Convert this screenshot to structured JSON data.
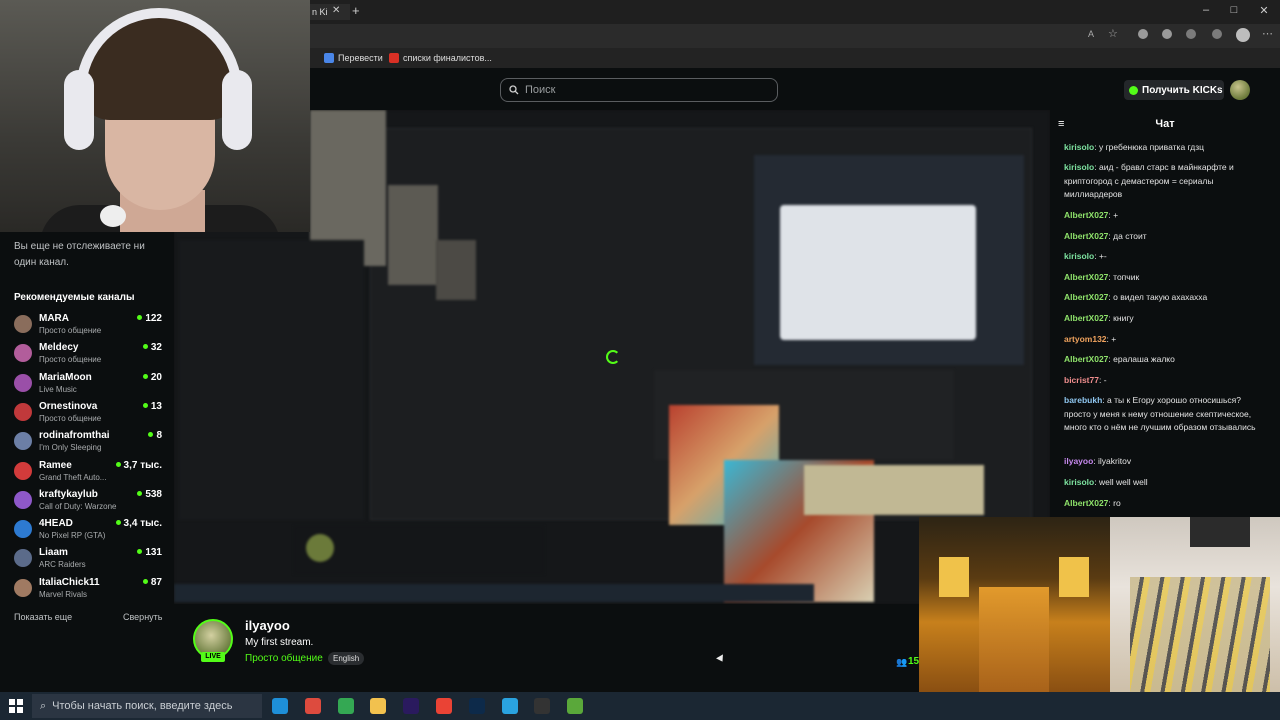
{
  "browser": {
    "tab_fragment": "n Ki",
    "window_controls": [
      "–",
      "□",
      "✕"
    ],
    "bookmarks": [
      {
        "label": "Перевести",
        "icon": "translate-icon",
        "color": "#4a86e8"
      },
      {
        "label": "списки финалистов...",
        "icon": "list-icon",
        "color": "#d93025"
      }
    ]
  },
  "header": {
    "search_placeholder": "Поиск",
    "kicks_button": "Получить KICKs"
  },
  "sidebar": {
    "not_following_text_line1": "Вы еще не отслеживаете ни",
    "not_following_text_line2": "один канал.",
    "recommended_title": "Рекомендуемые каналы",
    "channels": [
      {
        "name": "MARA",
        "category": "Просто общение",
        "viewers": "122",
        "color": "#8a6d5c"
      },
      {
        "name": "Meldecy",
        "category": "Просто общение",
        "viewers": "32",
        "color": "#b25d9b"
      },
      {
        "name": "MariaMoon",
        "category": "Live Music",
        "viewers": "20",
        "color": "#9a4fa8"
      },
      {
        "name": "Ornestinova",
        "category": "Просто общение",
        "viewers": "13",
        "color": "#c0393b"
      },
      {
        "name": "rodinafromthai",
        "category": "I'm Only Sleeping",
        "viewers": "8",
        "color": "#6c7fa6"
      },
      {
        "name": "Ramee",
        "category": "Grand Theft Auto...",
        "viewers": "3,7 тыс.",
        "color": "#d23b3b"
      },
      {
        "name": "kraftykaylub",
        "category": "Call of Duty: Warzone",
        "viewers": "538",
        "color": "#8e58c9"
      },
      {
        "name": "4HEAD",
        "category": "No Pixel RP (GTA)",
        "viewers": "3,4 тыс.",
        "color": "#2d7ad1"
      },
      {
        "name": "Liaam",
        "category": "ARC Raiders",
        "viewers": "131",
        "color": "#5b6b8a"
      },
      {
        "name": "ItaliaChick11",
        "category": "Marvel Rivals",
        "viewers": "87",
        "color": "#a07a62"
      }
    ],
    "show_more": "Показать еще",
    "collapse": "Свернуть"
  },
  "stream": {
    "streamer": "ilyayoo",
    "live_badge": "LIVE",
    "title": "My first stream.",
    "category": "Просто общение",
    "language": "English",
    "viewers": "15"
  },
  "chat": {
    "title": "Чат",
    "messages": [
      {
        "user": "kirisolo",
        "color": "#7ee3a0",
        "text": "у гребенюка приватка гдзц"
      },
      {
        "user": "kirisolo",
        "color": "#7ee3a0",
        "text": "аид - бравл старс в майнкарфте и криптогород с демастером = сериалы миллиардеров"
      },
      {
        "user": "AlbertX027",
        "color": "#8fe36b",
        "text": "+"
      },
      {
        "user": "AlbertX027",
        "color": "#8fe36b",
        "text": "да стоит"
      },
      {
        "user": "kirisolo",
        "color": "#7ee3a0",
        "text": "+-"
      },
      {
        "user": "AlbertX027",
        "color": "#8fe36b",
        "text": "топчик"
      },
      {
        "user": "AlbertX027",
        "color": "#8fe36b",
        "text": "о видел такую ахахахха"
      },
      {
        "user": "AlbertX027",
        "color": "#8fe36b",
        "text": "книгу"
      },
      {
        "user": "artyom132",
        "color": "#f0a35e",
        "text": "+"
      },
      {
        "user": "AlbertX027",
        "color": "#8fe36b",
        "text": "ералаша жалко"
      },
      {
        "user": "bicrist77",
        "color": "#f08e8e",
        "text": "-"
      },
      {
        "user": "barebukh",
        "color": "#8fc7f0",
        "text": "а ты к Егору хорошо относишься? просто у меня к нему отношение скептическое, много кто о нём не лучшим образом отзывались"
      },
      {
        "user": "ilyayoo",
        "color": "#c88af0",
        "text": "ilyakritov"
      },
      {
        "user": "kirisolo",
        "color": "#7ee3a0",
        "text": "well well well"
      },
      {
        "user": "AlbertX027",
        "color": "#8fe36b",
        "text": "ro"
      }
    ]
  },
  "taskbar": {
    "search_placeholder": "Чтобы начать поиск, введите здесь",
    "apps": [
      {
        "name": "edge-icon",
        "color": "#1e8fd8"
      },
      {
        "name": "chrome-icon",
        "color": "#dd4b3e"
      },
      {
        "name": "chrome-icon",
        "color": "#34a853"
      },
      {
        "name": "folder-icon",
        "color": "#f2c14e"
      },
      {
        "name": "premiere-icon",
        "color": "#2a1a5e"
      },
      {
        "name": "chrome-icon",
        "color": "#ea4335"
      },
      {
        "name": "photoshop-icon",
        "color": "#0d2a4a"
      },
      {
        "name": "telegram-icon",
        "color": "#2aa3e0"
      },
      {
        "name": "obs-icon",
        "color": "#333333"
      },
      {
        "name": "minecraft-icon",
        "color": "#5aa83a"
      }
    ]
  },
  "colors": {
    "accent": "#53fc18",
    "bg": "#0b0e0f"
  }
}
